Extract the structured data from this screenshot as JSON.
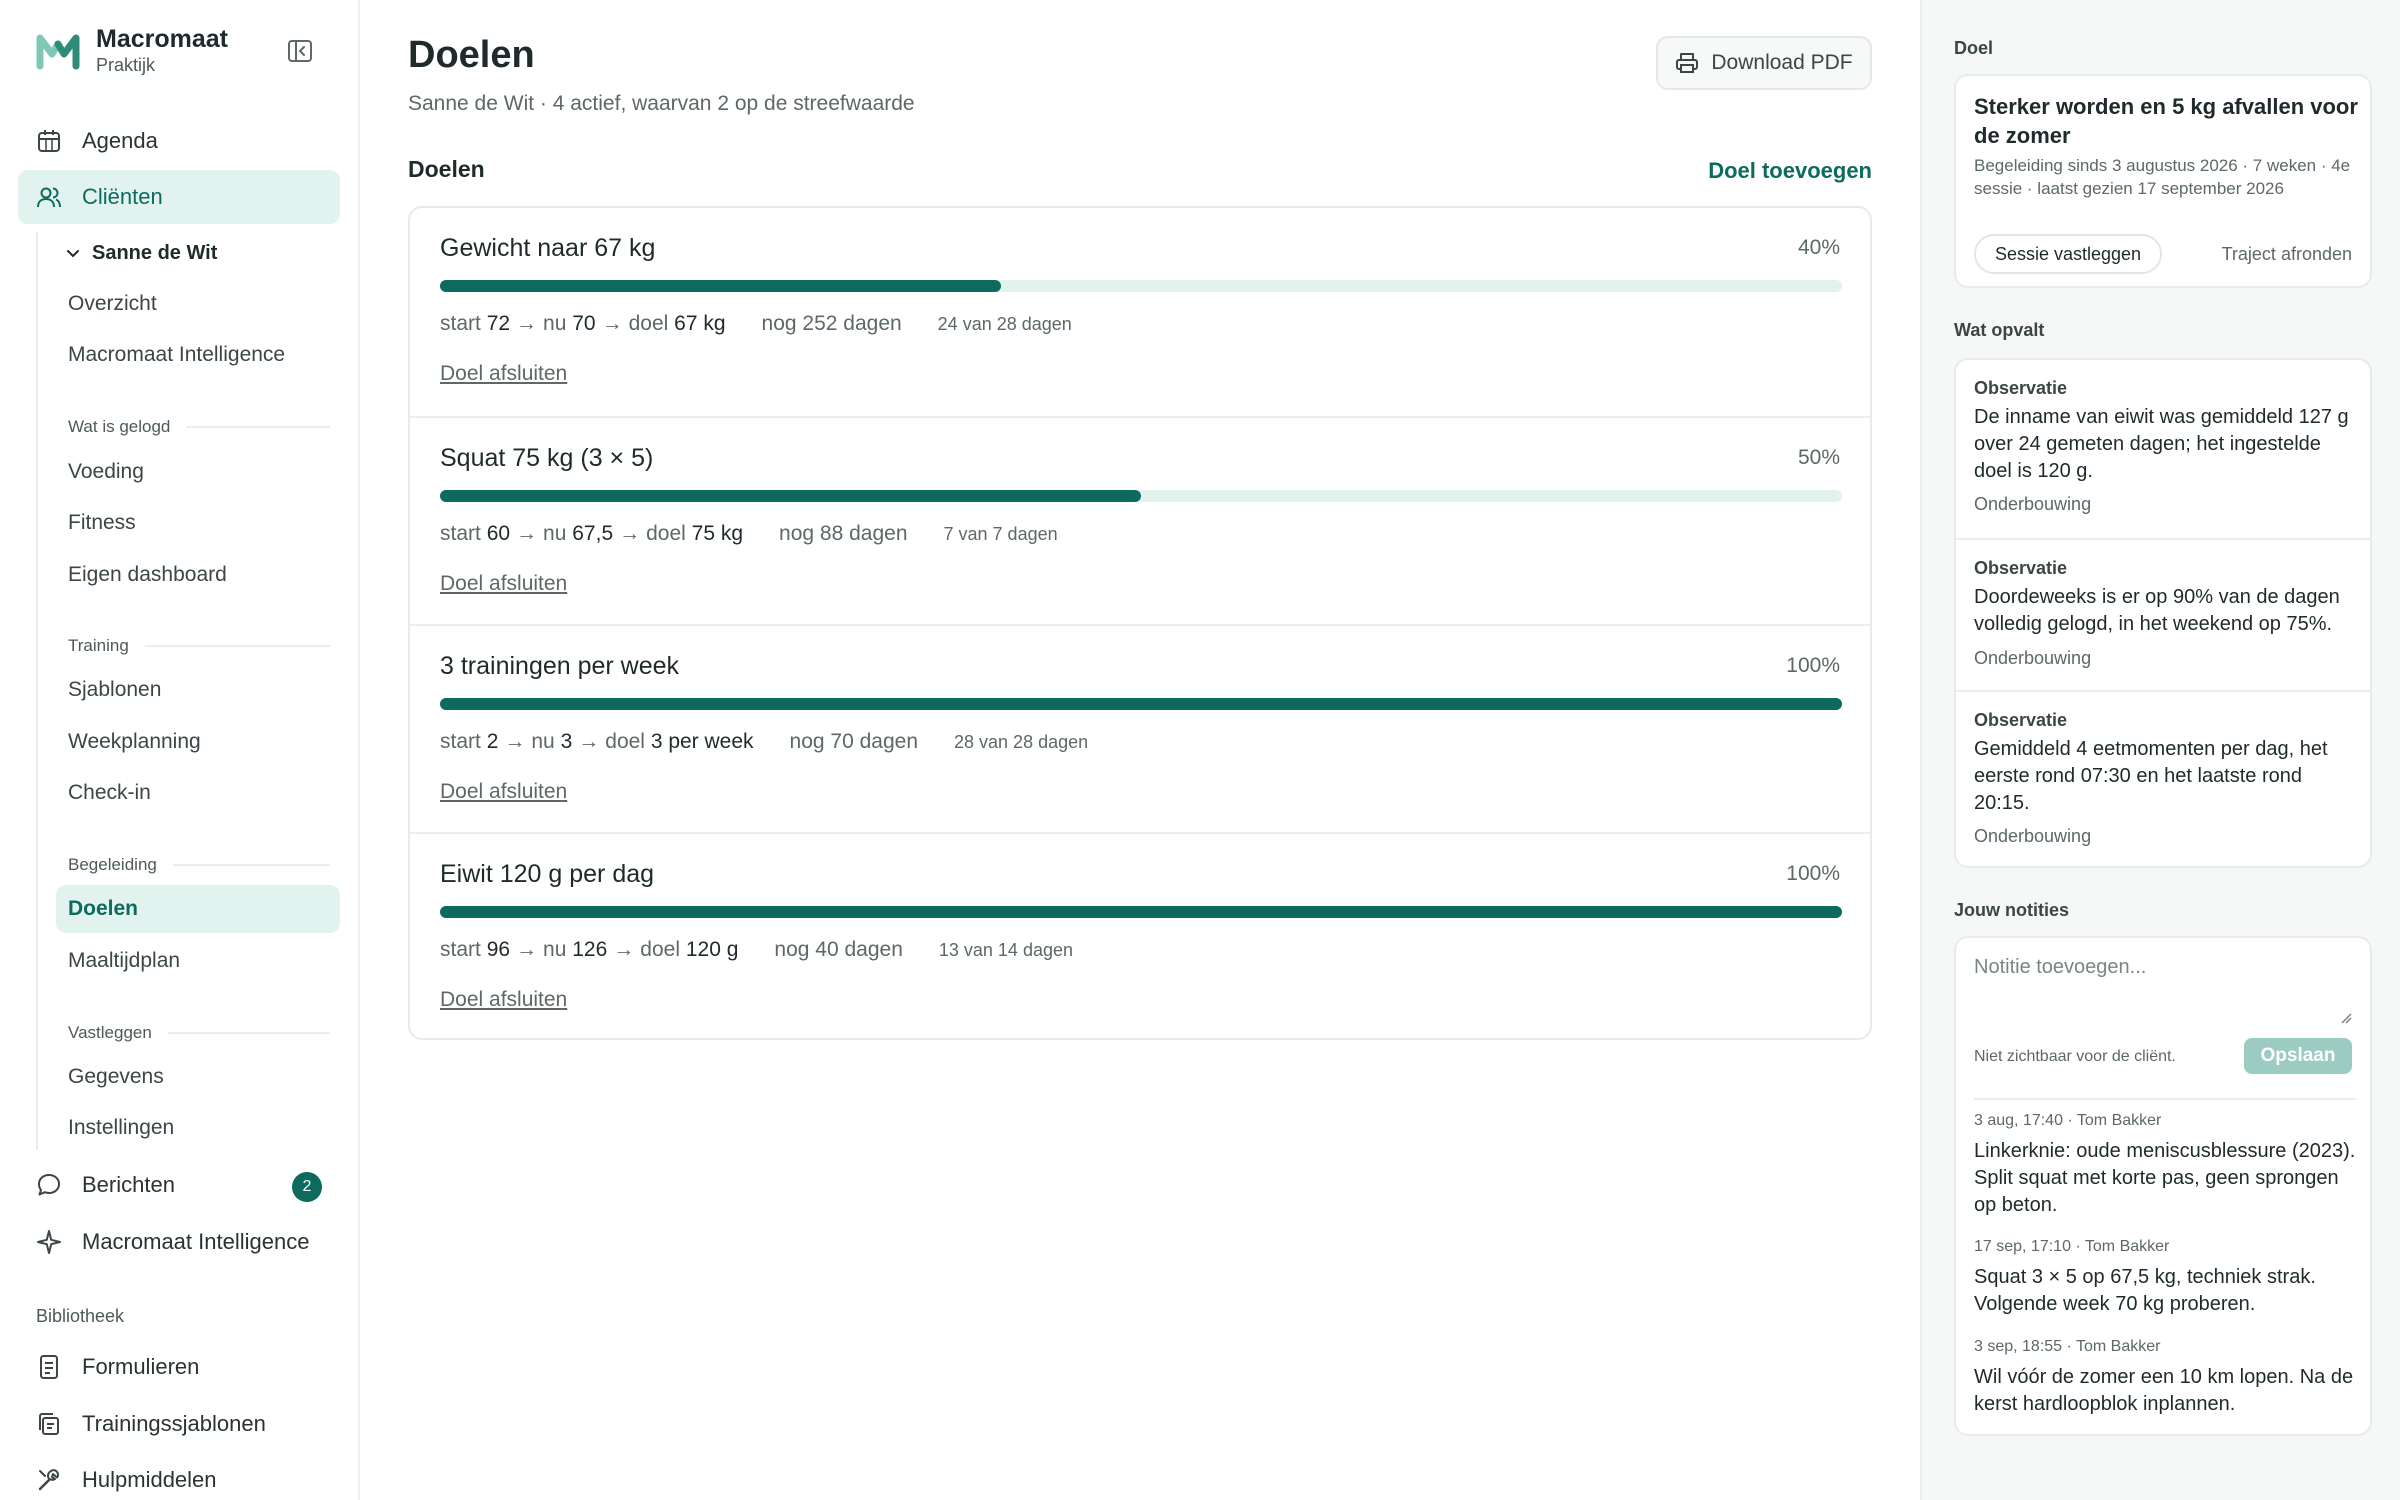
{
  "brand": {
    "name": "Macromaat",
    "subtitle": "Praktijk"
  },
  "nav": {
    "agenda": "Agenda",
    "clients": "Cliënten",
    "client_name": "Sanne de Wit",
    "overview": "Overzicht",
    "intelligence_sub": "Macromaat Intelligence",
    "logged_section": "Wat is gelogd",
    "voeding": "Voeding",
    "fitness": "Fitness",
    "dashboard": "Eigen dashboard",
    "training_section": "Training",
    "sjablonen": "Sjablonen",
    "weekplanning": "Weekplanning",
    "checkin": "Check-in",
    "guidance_section": "Begeleiding",
    "doelen": "Doelen",
    "maaltijdplan": "Maaltijdplan",
    "capture_section": "Vastleggen",
    "gegevens": "Gegevens",
    "instellingen": "Instellingen",
    "berichten": "Berichten",
    "berichten_count": "2",
    "intelligence": "Macromaat Intelligence",
    "library_heading": "Bibliotheek",
    "formulieren": "Formulieren",
    "trainingssjablonen": "Trainingssjablonen",
    "hulpmiddelen": "Hulpmiddelen"
  },
  "main": {
    "title": "Doelen",
    "subtitle": "Sanne de Wit · 4 actief, waarvan 2 op de streefwaarde",
    "download_pdf": "Download PDF",
    "section_title": "Doelen",
    "add_goal": "Doel toevoegen",
    "goals": [
      {
        "name": "Gewicht naar 67 kg",
        "percent_label": "40%",
        "progress": 0.4,
        "start_label": "start",
        "start": "72",
        "now_label": "nu",
        "now": "70",
        "target_label": "doel",
        "target": "67 kg",
        "remaining": "nog 252 dagen",
        "count": "24 van 28 dagen",
        "close": "Doel afsluiten"
      },
      {
        "name": "Squat 75 kg (3 × 5)",
        "percent_label": "50%",
        "progress": 0.5,
        "start_label": "start",
        "start": "60",
        "now_label": "nu",
        "now": "67,5",
        "target_label": "doel",
        "target": "75 kg",
        "remaining": "nog 88 dagen",
        "count": "7 van 7 dagen",
        "close": "Doel afsluiten"
      },
      {
        "name": "3 trainingen per week",
        "percent_label": "100%",
        "progress": 1.0,
        "start_label": "start",
        "start": "2",
        "now_label": "nu",
        "now": "3",
        "target_label": "doel",
        "target": "3 per week",
        "remaining": "nog 70 dagen",
        "count": "28 van 28 dagen",
        "close": "Doel afsluiten"
      },
      {
        "name": "Eiwit 120 g per dag",
        "percent_label": "100%",
        "progress": 1.0,
        "start_label": "start",
        "start": "96",
        "now_label": "nu",
        "now": "126",
        "target_label": "doel",
        "target": "120 g",
        "remaining": "nog 40 dagen",
        "count": "13 van 14 dagen",
        "close": "Doel afsluiten"
      }
    ]
  },
  "panel": {
    "goal_label": "Doel",
    "goal_title": "Sterker worden en 5 kg afvallen voor de zomer",
    "goal_info": "Begeleiding sinds 3 augustus 2026 · 7 weken · 4e sessie · laatst gezien 17 september 2026",
    "session_button": "Sessie vastleggen",
    "finish_button": "Traject afronden",
    "observations_label": "Wat opvalt",
    "observations": [
      {
        "label": "Observatie",
        "text": "De inname van eiwit was gemiddeld 127 g over 24 gemeten dagen; het ingestelde doel is 120 g.",
        "link": "Onderbouwing"
      },
      {
        "label": "Observatie",
        "text": "Doordeweeks is er op 90% van de dagen volledig gelogd, in het weekend op 75%.",
        "link": "Onderbouwing"
      },
      {
        "label": "Observatie",
        "text": "Gemiddeld 4 eetmomenten per dag, het eerste rond 07:30 en het laatste rond 20:15.",
        "link": "Onderbouwing"
      }
    ],
    "notes_label": "Jouw notities",
    "note_placeholder": "Notitie toevoegen...",
    "note_hint": "Niet zichtbaar voor de cliënt.",
    "save_button": "Opslaan",
    "notes": [
      {
        "meta": "3 aug, 17:40 · Tom Bakker",
        "text": "Linkerknie: oude meniscusblessure (2023). Split squat met korte pas, geen sprongen op beton."
      },
      {
        "meta": "17 sep, 17:10 · Tom Bakker",
        "text": "Squat 3 × 5 op 67,5 kg, techniek strak. Volgende week 70 kg proberen."
      },
      {
        "meta": "3 sep, 18:55 · Tom Bakker",
        "text": "Wil vóór de zomer een 10 km lopen. Na de kerst hardloopblok inplannen."
      }
    ]
  },
  "colors": {
    "accent": "#0d6b5e",
    "accent_light": "#e2f2ee",
    "track": "#e4f2ee",
    "save_disabled": "#9ccbc2"
  }
}
